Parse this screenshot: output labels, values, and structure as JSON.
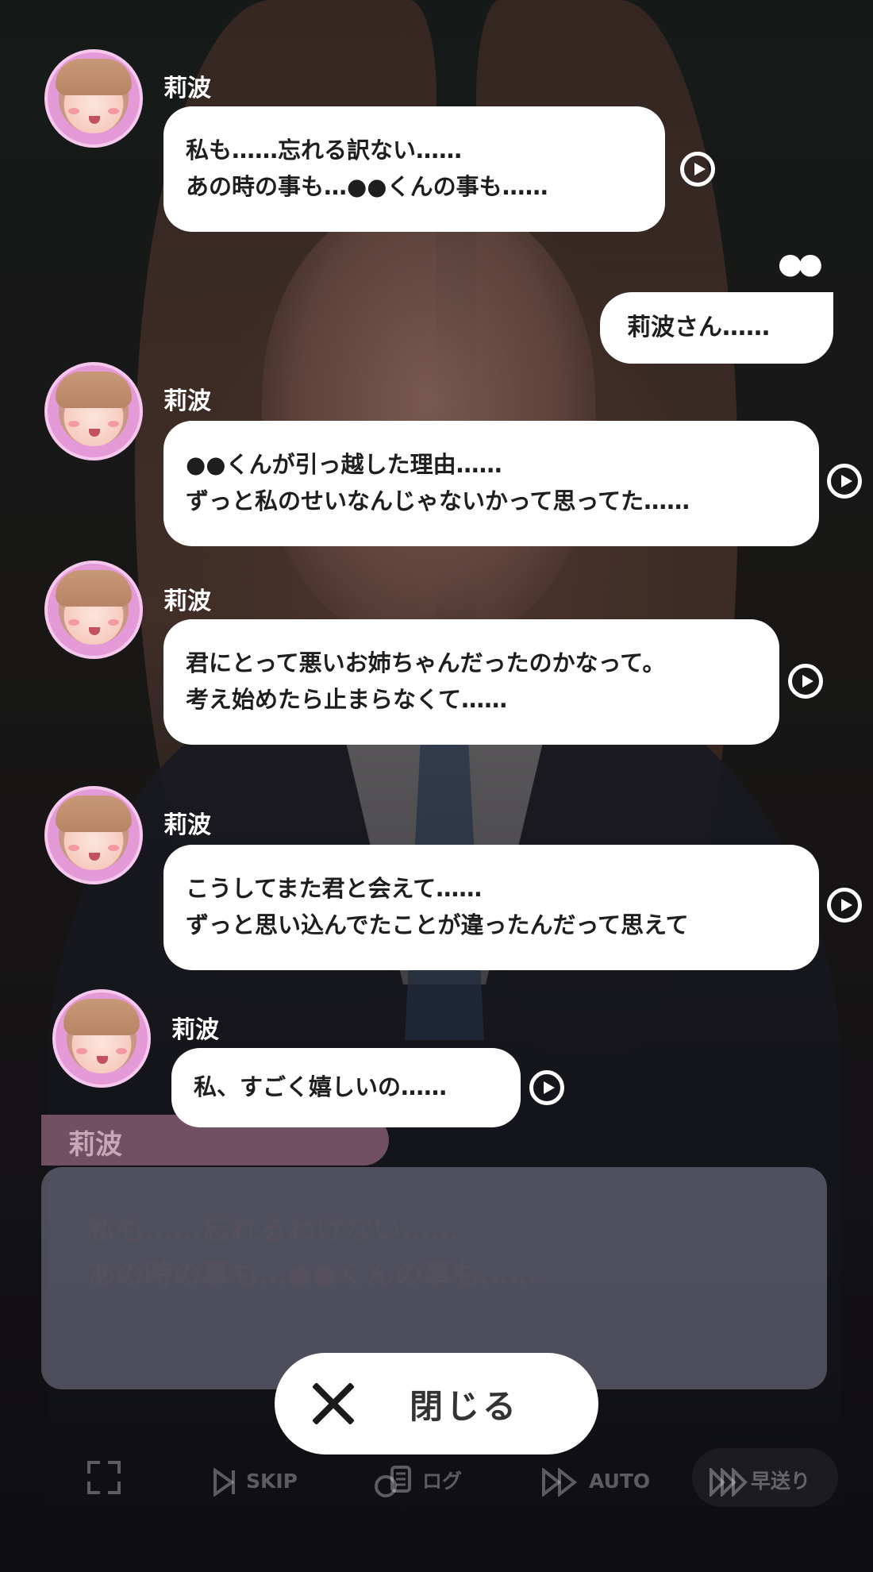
{
  "speaker_name": "莉波",
  "player_name": "●●",
  "messages": [
    {
      "lines": [
        "私も……忘れる訳ない……",
        "あの時の事も…●●くんの事も……"
      ]
    },
    {
      "player": true,
      "text": "莉波さん……"
    },
    {
      "lines": [
        "●●くんが引っ越した理由……",
        "ずっと私のせいなんじゃないかって思ってた……"
      ]
    },
    {
      "lines": [
        "君にとって悪いお姉ちゃんだったのかなって。",
        "考え始めたら止まらなくて……"
      ]
    },
    {
      "lines": [
        "こうしてまた君と会えて……",
        "ずっと思い込んでたことが違ったんだって思えて"
      ]
    },
    {
      "lines": [
        "私、すごく嬉しいの……"
      ]
    }
  ],
  "dialog": {
    "name": "莉波",
    "lines": [
      "私も……忘れるわけない……",
      "あの時の事も…●●くんの事も……"
    ]
  },
  "close_button": {
    "label": "閉じる",
    "icon": "close-icon"
  },
  "toolbar": {
    "fullscreen_icon": "fullscreen-icon",
    "skip": "SKIP",
    "log": "ログ",
    "auto": "AUTO",
    "fast_forward": "早送り"
  },
  "colors": {
    "avatar_ring": "#f7c8ee",
    "bubble": "#ffffff",
    "nameplate": "#be82a0"
  }
}
